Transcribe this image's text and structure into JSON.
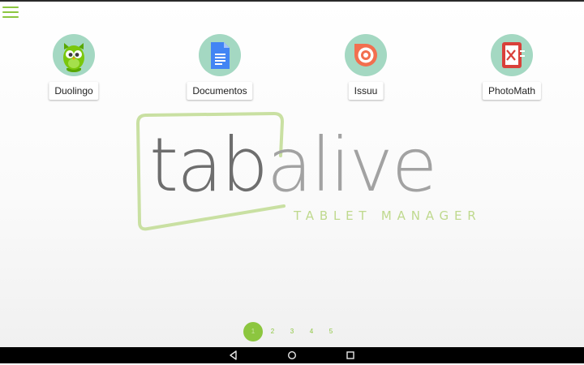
{
  "apps": [
    {
      "label": "Duolingo",
      "icon": "duolingo-owl-icon"
    },
    {
      "label": "Documentos",
      "icon": "google-docs-icon"
    },
    {
      "label": "Issuu",
      "icon": "issuu-icon"
    },
    {
      "label": "PhotoMath",
      "icon": "photomath-icon"
    }
  ],
  "logo": {
    "word_part1": "tab",
    "word_part2": "alive",
    "tagline": "TABLET MANAGER"
  },
  "pager": {
    "pages": [
      "1",
      "2",
      "3",
      "4",
      "5"
    ],
    "active_page": "1"
  },
  "navbar": {
    "icons": [
      "back-icon",
      "home-icon",
      "recents-icon"
    ]
  },
  "colors": {
    "accent": "#8cc63f",
    "icon_circle": "#a4d8c2",
    "issuu": "#f26f4f",
    "docs": "#4285f4",
    "photomath": "#d9403a"
  }
}
